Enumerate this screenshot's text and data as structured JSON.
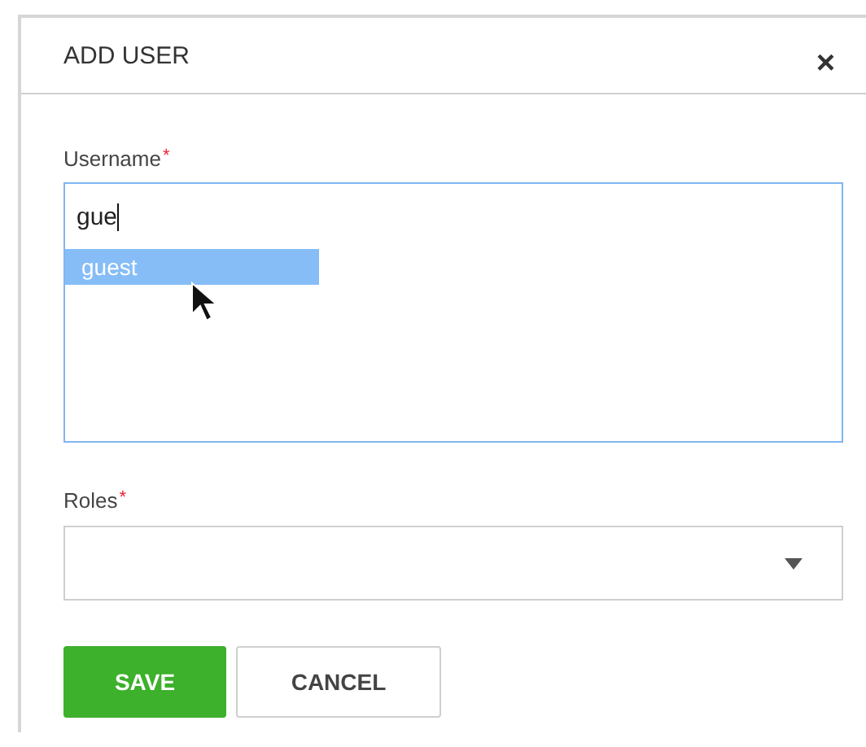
{
  "dialog": {
    "title": "ADD USER",
    "close": "×"
  },
  "fields": [
    {
      "kind": "autocomplete",
      "label": "Username",
      "required_mark": "*",
      "value": "gue",
      "focused": true,
      "suggestions": [
        {
          "label": "guest",
          "selected": true
        }
      ]
    },
    {
      "kind": "select",
      "label": "Roles",
      "required_mark": "*",
      "focused": false
    }
  ],
  "buttons": [
    {
      "label": "SAVE",
      "primary": true
    },
    {
      "label": "CANCEL",
      "primary": false
    }
  ]
}
